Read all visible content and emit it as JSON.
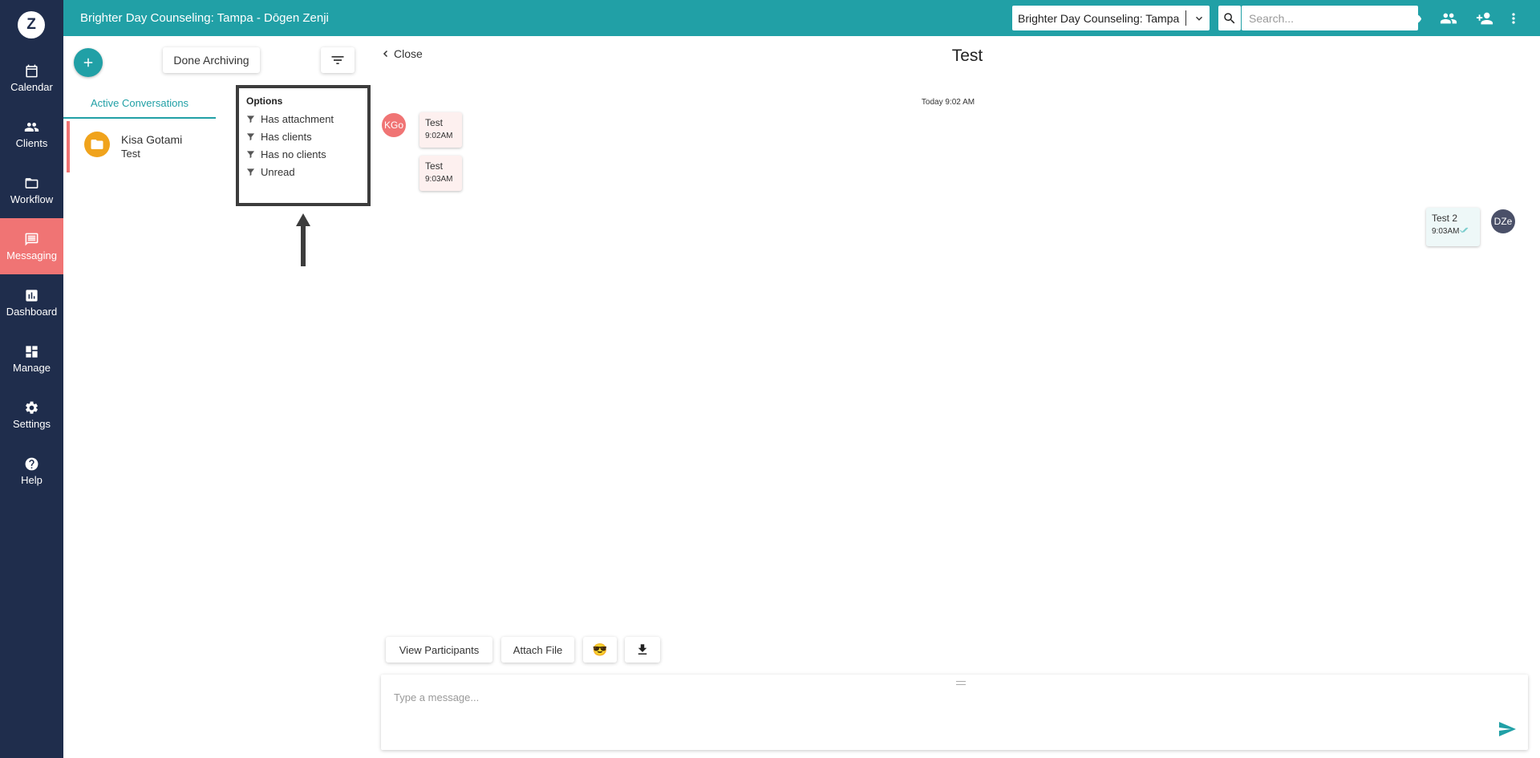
{
  "app": {
    "logo_letter": "Z",
    "brand_color": "#21a0a6",
    "sidebar_color": "#1f2d4c",
    "active_color": "#f07474"
  },
  "sidebar": {
    "items": [
      {
        "label": "Calendar",
        "icon": "calendar-icon"
      },
      {
        "label": "Clients",
        "icon": "people-icon"
      },
      {
        "label": "Workflow",
        "icon": "folder-icon"
      },
      {
        "label": "Messaging",
        "icon": "message-icon",
        "active": true
      },
      {
        "label": "Dashboard",
        "icon": "chart-icon"
      },
      {
        "label": "Manage",
        "icon": "dashboard-icon"
      },
      {
        "label": "Settings",
        "icon": "gear-icon"
      },
      {
        "label": "Help",
        "icon": "help-icon"
      }
    ]
  },
  "topbar": {
    "title": "Brighter Day Counseling: Tampa - Dōgen Zenji",
    "location_select": "Brighter Day Counseling: Tampa",
    "search_placeholder": "Search...",
    "icons": [
      "search-icon",
      "bell-icon",
      "eye-icon",
      "group-icon",
      "add-person-icon",
      "more-vert-icon"
    ]
  },
  "conversations": {
    "done_archiving_label": "Done Archiving",
    "tab_active": "Active Conversations",
    "items": [
      {
        "name": "Kisa Gotami",
        "subject": "Test"
      }
    ]
  },
  "options_menu": {
    "header": "Options",
    "items": [
      "Has attachment",
      "Has clients",
      "Has no clients",
      "Unread"
    ]
  },
  "chat": {
    "close_label": "Close",
    "title": "Test",
    "day_stamp": "Today 9:02 AM",
    "incoming_avatar": "KGo",
    "outgoing_avatar": "DZe",
    "messages": [
      {
        "text": "Test",
        "time": "9:02AM",
        "direction": "in"
      },
      {
        "text": "Test",
        "time": "9:03AM",
        "direction": "in"
      },
      {
        "text": "Test 2",
        "time": "9:03AM",
        "direction": "out"
      }
    ],
    "tools": {
      "view_participants": "View Participants",
      "attach_file": "Attach File",
      "emoji": "😎"
    },
    "composer_placeholder": "Type a message..."
  }
}
